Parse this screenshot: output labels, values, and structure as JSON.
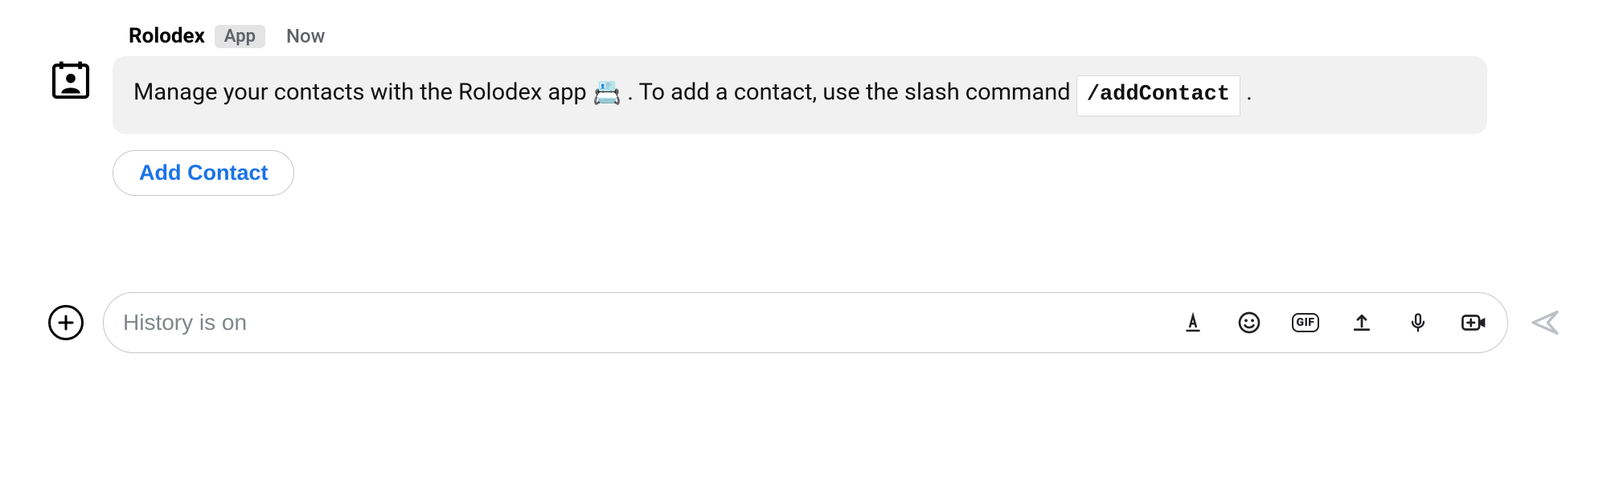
{
  "message": {
    "sender_name": "Rolodex",
    "app_badge": "App",
    "timestamp": "Now",
    "body_part1": "Manage your contacts with the Rolodex app ",
    "body_part2": ". To add a contact, use the slash command ",
    "slash_command": "/addContact",
    "body_part3": ".",
    "emoji": "📇",
    "action_button": "Add Contact"
  },
  "composer": {
    "placeholder": "History is on",
    "gif_label": "GIF"
  }
}
